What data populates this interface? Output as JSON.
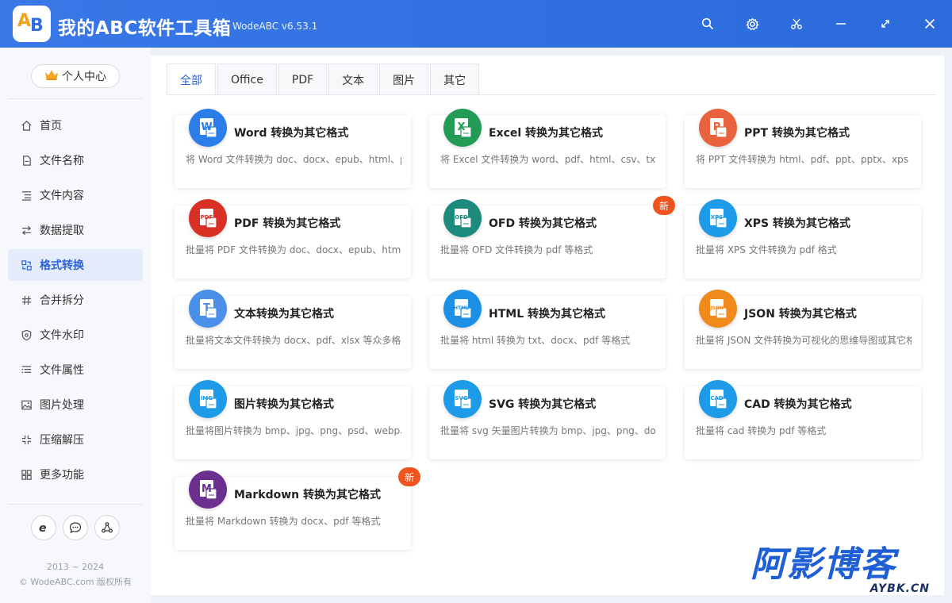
{
  "titlebar": {
    "title": "我的ABC软件工具箱",
    "version": "WodeABC v6.53.1",
    "logo_text_a": "A",
    "logo_text_b": "B",
    "buttons": [
      "search-icon",
      "gear-icon",
      "scissors-icon",
      "minimize-icon",
      "maximize-icon",
      "close-icon"
    ]
  },
  "sidebar": {
    "profile_label": "个人中心",
    "items": [
      {
        "label": "首页",
        "icon": "home-icon"
      },
      {
        "label": "文件名称",
        "icon": "file-name-icon"
      },
      {
        "label": "文件内容",
        "icon": "file-content-icon"
      },
      {
        "label": "数据提取",
        "icon": "data-extract-icon"
      },
      {
        "label": "格式转换",
        "icon": "format-convert-icon",
        "active": true
      },
      {
        "label": "合并拆分",
        "icon": "merge-split-icon"
      },
      {
        "label": "文件水印",
        "icon": "watermark-icon"
      },
      {
        "label": "文件属性",
        "icon": "file-props-icon"
      },
      {
        "label": "图片处理",
        "icon": "image-icon"
      },
      {
        "label": "压缩解压",
        "icon": "compress-icon"
      },
      {
        "label": "更多功能",
        "icon": "grid-icon"
      }
    ],
    "bottom_icons": [
      "browser-icon",
      "chat-icon",
      "share-icon"
    ],
    "copyright_years": "2013 ~ 2024",
    "copyright_text": "© WodeABC.com 版权所有"
  },
  "tabs": [
    {
      "label": "全部",
      "active": true
    },
    {
      "label": "Office"
    },
    {
      "label": "PDF"
    },
    {
      "label": "文本"
    },
    {
      "label": "图片"
    },
    {
      "label": "其它"
    }
  ],
  "cards": [
    {
      "title": "Word 转换为其它格式",
      "desc": "将 Word 文件转换为 doc、docx、epub、html、pdf",
      "icon": "word-icon",
      "glyph": "W",
      "color": "#2b7de9"
    },
    {
      "title": "Excel 转换为其它格式",
      "desc": "将 Excel 文件转换为 word、pdf、html、csv、txt、s",
      "icon": "excel-icon",
      "glyph": "X",
      "color": "#239b56"
    },
    {
      "title": "PPT 转换为其它格式",
      "desc": "将 PPT 文件转换为 html、pdf、ppt、pptx、xps 等多",
      "icon": "ppt-icon",
      "glyph": "P",
      "color": "#e8633d"
    },
    {
      "title": "PDF 转换为其它格式",
      "desc": "批量将 PDF 文件转换为 doc、docx、epub、html、",
      "icon": "pdf-icon",
      "glyph": "PDF",
      "color": "#d93025"
    },
    {
      "title": "OFD 转换为其它格式",
      "desc": "批量将 OFD 文件转换为 pdf 等格式",
      "icon": "ofd-icon",
      "glyph": "OFD",
      "color": "#1d8a7e",
      "badge": "新"
    },
    {
      "title": "XPS 转换为其它格式",
      "desc": "批量将 XPS 文件转换为 pdf 格式",
      "icon": "xps-icon",
      "glyph": "XPS",
      "color": "#1e9be8"
    },
    {
      "title": "文本转换为其它格式",
      "desc": "批量将文本文件转换为 docx、pdf、xlsx 等众多格式",
      "icon": "text-icon",
      "glyph": "T",
      "color": "#4a90e8"
    },
    {
      "title": "HTML 转换为其它格式",
      "desc": "批量将 html 转换为 txt、docx、pdf 等格式",
      "icon": "html-icon",
      "glyph": "HTML",
      "color": "#1e8fe6"
    },
    {
      "title": "JSON 转换为其它格式",
      "desc": "批量将 JSON 文件转换为可视化的思维导图或其它格",
      "icon": "json-icon",
      "glyph": "JSON",
      "color": "#f08a1a"
    },
    {
      "title": "图片转换为其它格式",
      "desc": "批量将图片转换为 bmp、jpg、png、psd、webp、",
      "icon": "picture-icon",
      "glyph": "IMG",
      "color": "#1e9be8"
    },
    {
      "title": "SVG 转换为其它格式",
      "desc": "批量将 svg 矢量图片转换为 bmp、jpg、png、docx",
      "icon": "svg-icon",
      "glyph": "SVG",
      "color": "#1e9be8"
    },
    {
      "title": "CAD 转换为其它格式",
      "desc": "批量将 cad 转换为 pdf 等格式",
      "icon": "cad-icon",
      "glyph": "CAD",
      "color": "#1e9be8"
    },
    {
      "title": "Markdown 转换为其它格式",
      "desc": "批量将 Markdown 转换为 docx、pdf 等格式",
      "icon": "markdown-icon",
      "glyph": "M",
      "color": "#6b2f8f",
      "badge": "新"
    }
  ],
  "watermark": {
    "main": "阿影博客",
    "sub": "AYBK.CN"
  }
}
